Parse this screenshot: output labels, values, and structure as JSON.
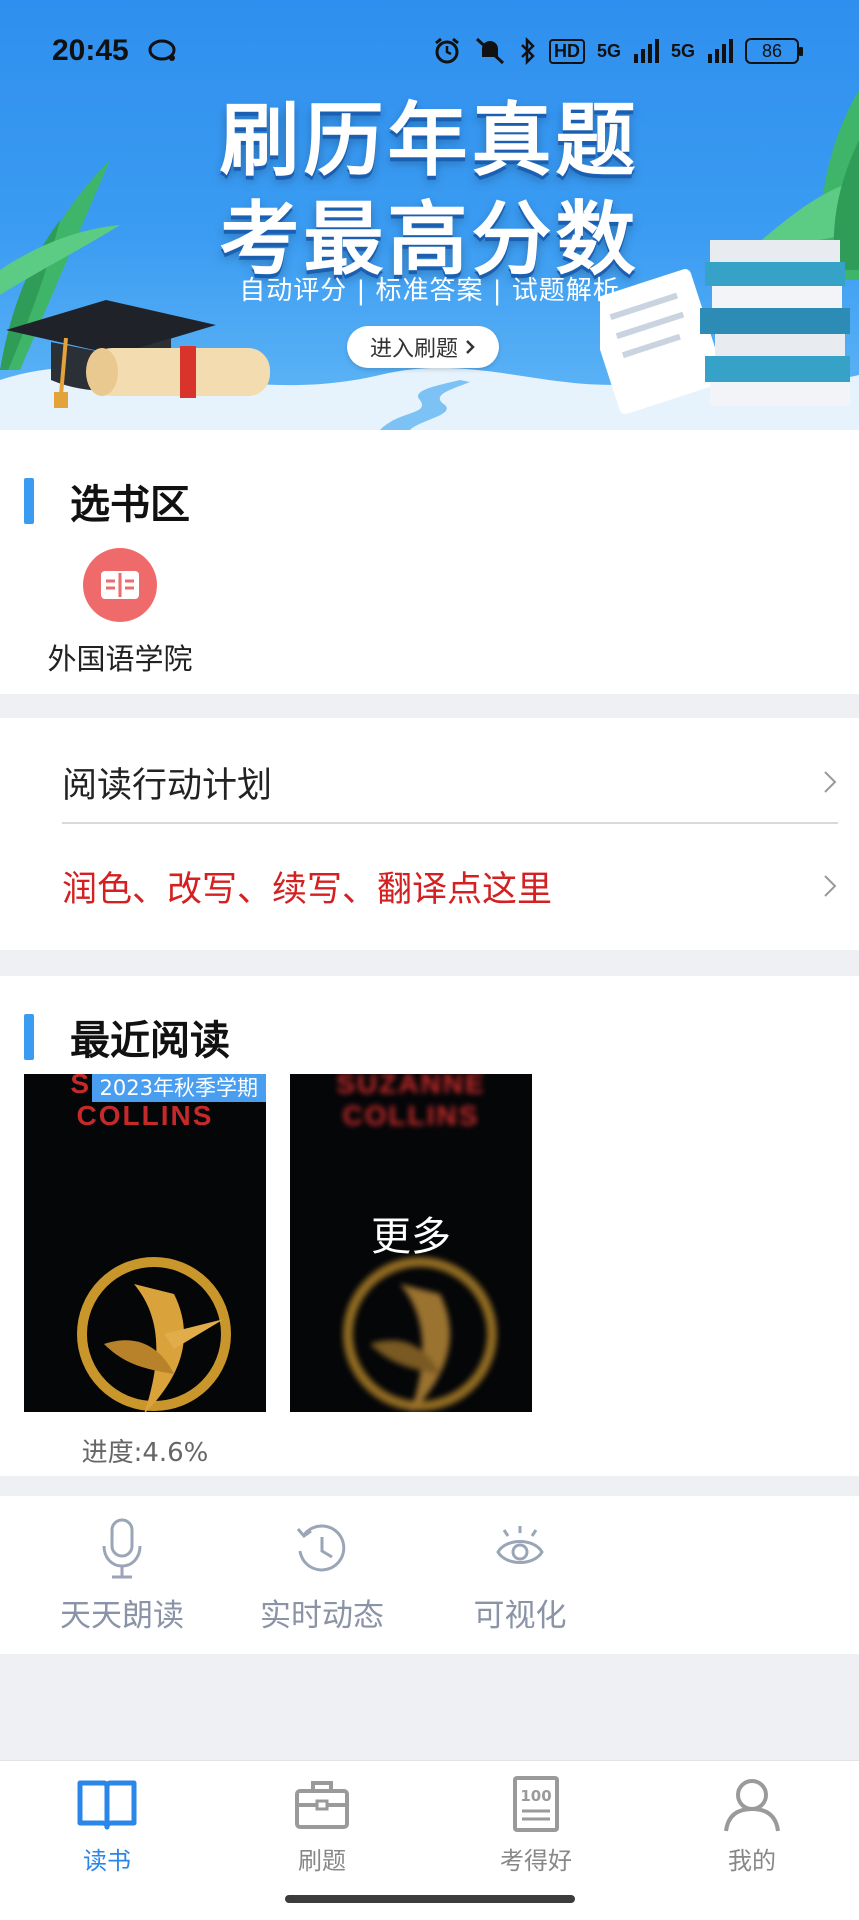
{
  "status_bar": {
    "time": "20:45",
    "network_1": "5G",
    "network_2": "5G",
    "hd_label": "HD",
    "battery": "86"
  },
  "banner": {
    "title_line1": "刷历年真题",
    "title_line2": "考最高分数",
    "subtitle": "自动评分 | 标准答案 | 试题解析",
    "button_label": "进入刷题"
  },
  "book_select": {
    "title": "选书区",
    "items": [
      {
        "label": "外国语学院",
        "icon": "book-icon"
      }
    ]
  },
  "menu": {
    "items": [
      {
        "label": "阅读行动计划",
        "color": "#222222"
      },
      {
        "label": "润色、改写、续写、翻译点这里",
        "color": "#d42020"
      }
    ]
  },
  "recent": {
    "title": "最近阅读",
    "books": [
      {
        "tag": "2023年秋季学期",
        "cover_text": "SUZANNE COLLINS",
        "progress": "进度:4.6%"
      },
      {
        "cover_text": "SUZANNE COLLINS",
        "overlay": "更多"
      }
    ]
  },
  "features": [
    {
      "label": "天天朗读",
      "icon": "microphone-icon"
    },
    {
      "label": "实时动态",
      "icon": "history-icon"
    },
    {
      "label": "可视化",
      "icon": "eye-icon"
    }
  ],
  "bottom_nav": {
    "items": [
      {
        "label": "读书",
        "icon": "open-book-icon",
        "active": true
      },
      {
        "label": "刷题",
        "icon": "toolbox-icon",
        "active": false
      },
      {
        "label": "考得好",
        "icon": "score-paper-icon",
        "active": false
      },
      {
        "label": "我的",
        "icon": "person-icon",
        "active": false
      }
    ]
  },
  "colors": {
    "accent": "#2a86e8",
    "section_bar": "#3a9cf0",
    "highlight_red": "#d42020",
    "icon_red": "#ef6a6a"
  }
}
